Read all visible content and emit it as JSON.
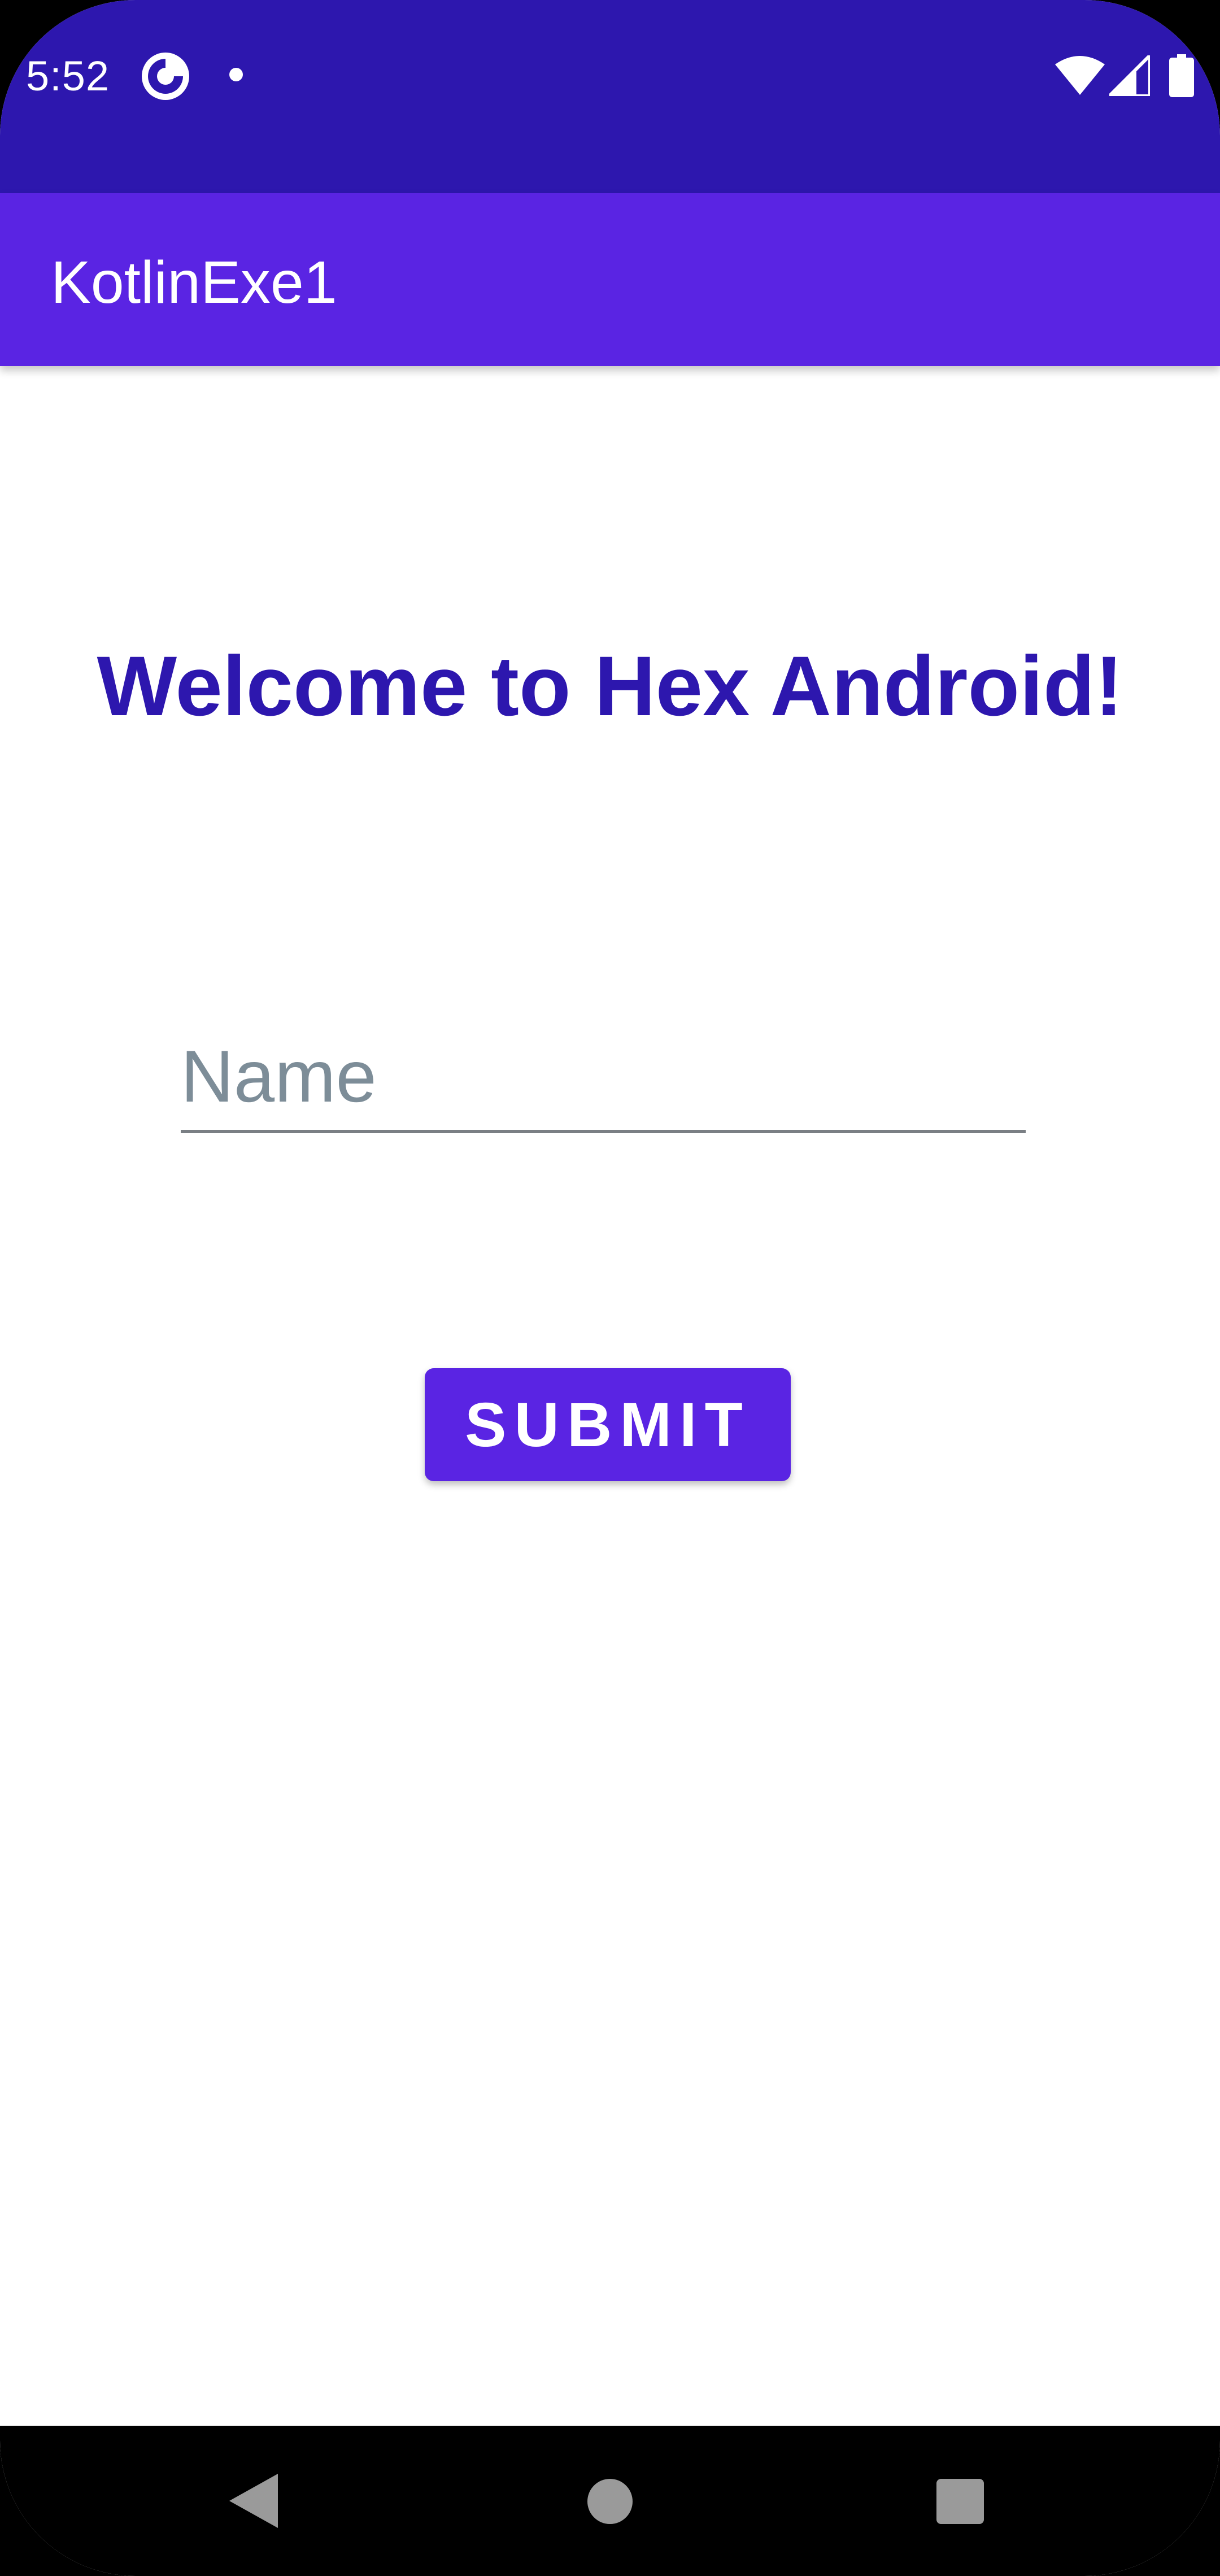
{
  "status_bar": {
    "time": "5:52",
    "icons": [
      "app-notification-icon",
      "dot-icon",
      "wifi-icon",
      "signal-icon",
      "battery-icon"
    ]
  },
  "app_bar": {
    "title": "KotlinExe1"
  },
  "main": {
    "welcome_text": "Welcome to Hex Android!",
    "name_input": {
      "placeholder": "Name",
      "value": ""
    },
    "submit_label": "SUBMIT"
  },
  "nav_bar": {
    "icons": [
      "back-icon",
      "home-icon",
      "recents-icon"
    ]
  },
  "colors": {
    "status_bar": "#2D17AE",
    "app_bar": "#5A24E3",
    "button": "#5A24E3",
    "welcome_text": "#2D17AE"
  }
}
